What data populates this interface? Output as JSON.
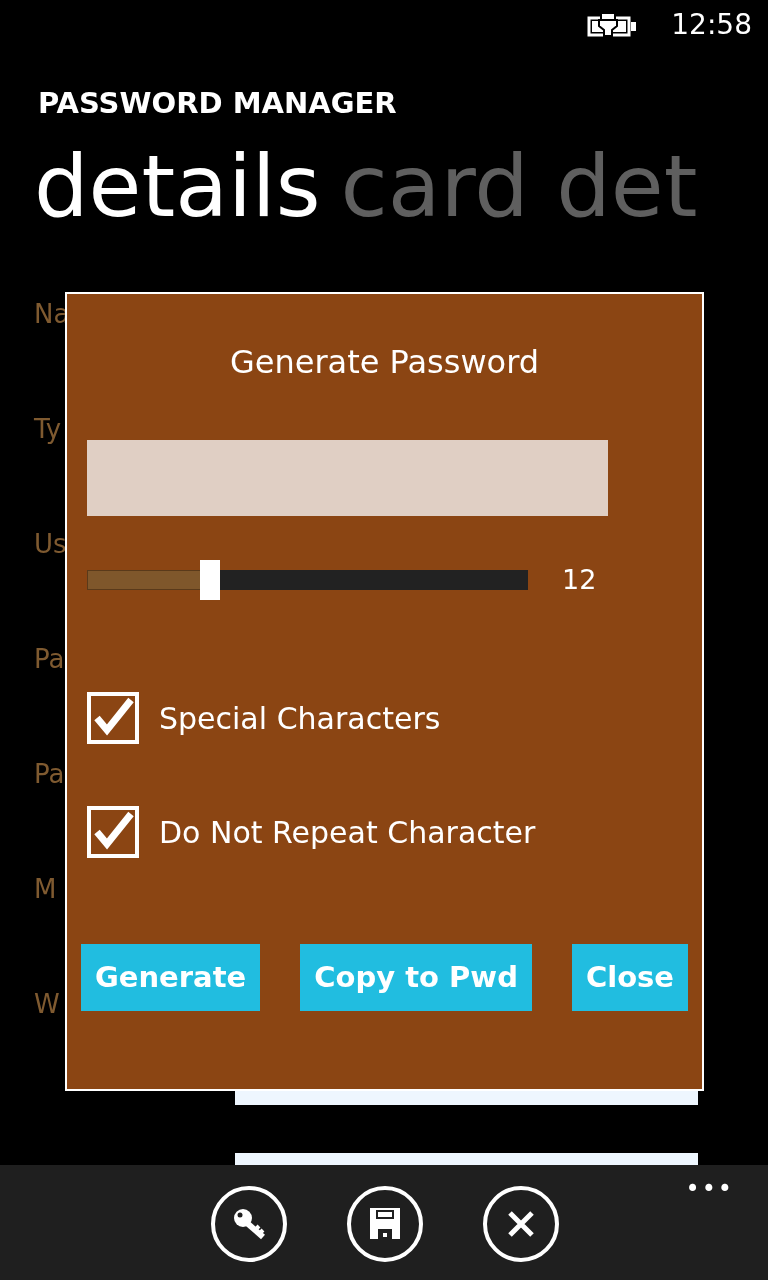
{
  "status_bar": {
    "charging": true,
    "time": "12:58"
  },
  "app_title": "PASSWORD MANAGER",
  "pivot": [
    {
      "label": "details",
      "selected": true
    },
    {
      "label": "card det",
      "selected": false
    }
  ],
  "form_labels": [
    "Na",
    "Ty",
    "Us",
    "Pa",
    "Pa",
    "M",
    "W"
  ],
  "dialog": {
    "title": "Generate Password",
    "length": {
      "level": 0.26,
      "reading": "12"
    },
    "options": [
      {
        "label": "Special Characters",
        "checked": true
      },
      {
        "label": "Do Not Repeat Character",
        "checked": true
      }
    ],
    "buttons": [
      "Generate",
      "Copy to Pwd",
      "Close"
    ]
  },
  "app_bar": {
    "buttons": [
      {
        "kind": "key"
      },
      {
        "kind": "save"
      },
      {
        "kind": "close"
      }
    ],
    "more": "•••"
  }
}
